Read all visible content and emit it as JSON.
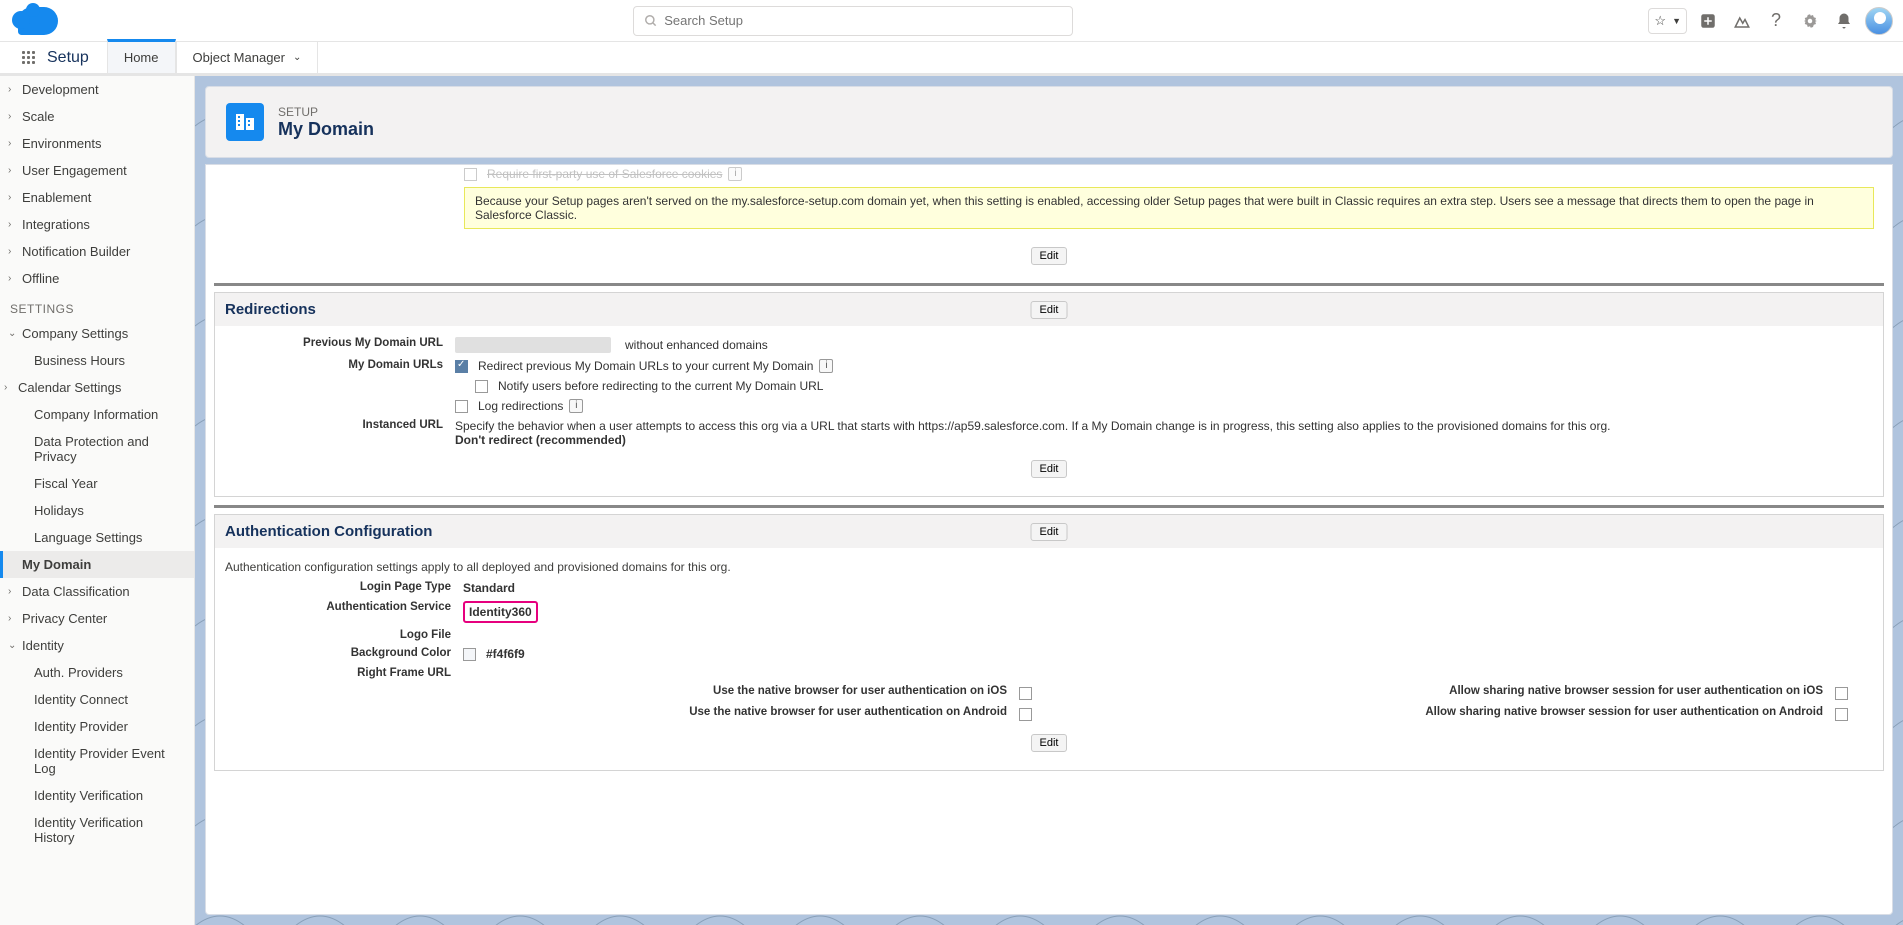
{
  "header": {
    "search_placeholder": "Search Setup"
  },
  "context": {
    "app_name": "Setup",
    "tabs": [
      {
        "label": "Home",
        "active": true
      },
      {
        "label": "Object Manager",
        "active": false
      }
    ]
  },
  "sidebar": {
    "top_items": [
      {
        "label": "Development"
      },
      {
        "label": "Scale"
      },
      {
        "label": "Environments"
      },
      {
        "label": "User Engagement"
      },
      {
        "label": "Enablement"
      },
      {
        "label": "Integrations"
      },
      {
        "label": "Notification Builder"
      },
      {
        "label": "Offline"
      }
    ],
    "settings_label": "SETTINGS",
    "company": {
      "label": "Company Settings",
      "children": [
        {
          "label": "Business Hours"
        },
        {
          "label": "Calendar Settings",
          "expandable": true
        },
        {
          "label": "Company Information"
        },
        {
          "label": "Data Protection and Privacy"
        },
        {
          "label": "Fiscal Year"
        },
        {
          "label": "Holidays"
        },
        {
          "label": "Language Settings"
        },
        {
          "label": "My Domain",
          "selected": true
        }
      ]
    },
    "after_items": [
      {
        "label": "Data Classification"
      },
      {
        "label": "Privacy Center"
      }
    ],
    "identity": {
      "label": "Identity",
      "children": [
        {
          "label": "Auth. Providers"
        },
        {
          "label": "Identity Connect"
        },
        {
          "label": "Identity Provider"
        },
        {
          "label": "Identity Provider Event Log"
        },
        {
          "label": "Identity Verification"
        },
        {
          "label": "Identity Verification History"
        }
      ]
    }
  },
  "page": {
    "eyebrow": "SETUP",
    "title": "My Domain"
  },
  "cutoff": {
    "checkbox_label": "Require first-party use of Salesforce cookies",
    "warning": "Because your Setup pages aren't served on the my.salesforce-setup.com domain yet, when this setting is enabled, accessing older Setup pages that were built in Classic requires an extra step. Users see a message that directs them to open the page in Salesforce Classic.",
    "edit_label": "Edit"
  },
  "redirections": {
    "title": "Redirections",
    "edit_label": "Edit",
    "rows": {
      "prev_url_label": "Previous My Domain URL",
      "prev_url_suffix": "without enhanced domains",
      "my_domain_urls_label": "My Domain URLs",
      "redirect_prev": "Redirect previous My Domain URLs to your current My Domain",
      "notify_users": "Notify users before redirecting to the current My Domain URL",
      "log_redirections": "Log redirections",
      "instanced_url_label": "Instanced URL",
      "instanced_text": "Specify the behavior when a user attempts to access this org via a URL that starts with https://ap59.salesforce.com. If a My Domain change is in progress, this setting also applies to the provisioned domains for this org.",
      "instanced_bold": "Don't redirect (recommended)"
    },
    "edit_bottom": "Edit"
  },
  "auth": {
    "title": "Authentication Configuration",
    "edit_label": "Edit",
    "intro": "Authentication configuration settings apply to all deployed and provisioned domains for this org.",
    "rows": {
      "login_page_type_label": "Login Page Type",
      "login_page_type_value": "Standard",
      "auth_service_label": "Authentication Service",
      "auth_service_value": "Identity360",
      "logo_file_label": "Logo File",
      "bg_color_label": "Background Color",
      "bg_color_value": "#f4f6f9",
      "right_frame_label": "Right Frame URL",
      "native_ios_left": "Use the native browser for user authentication on iOS",
      "native_ios_right": "Allow sharing native browser session for user authentication on iOS",
      "native_android_left": "Use the native browser for user authentication on Android",
      "native_android_right": "Allow sharing native browser session for user authentication on Android"
    },
    "edit_bottom": "Edit"
  }
}
